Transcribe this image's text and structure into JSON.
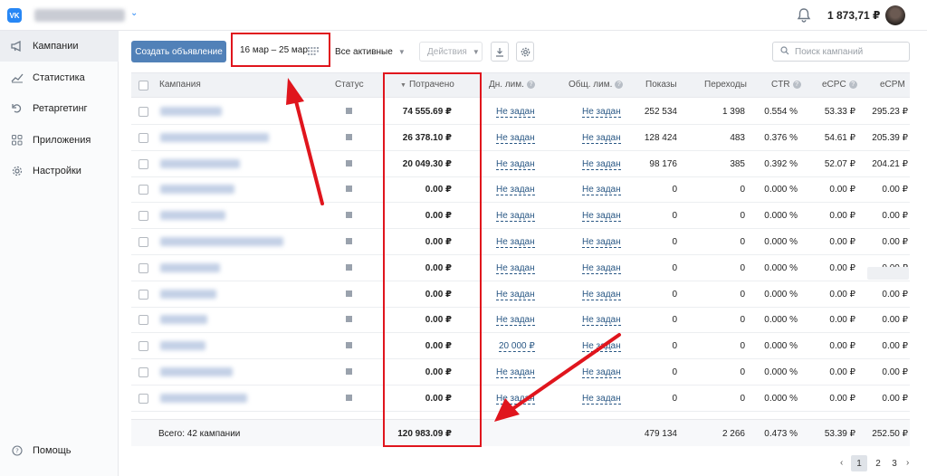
{
  "topbar": {
    "logo_text": "VK",
    "balance": "1 873,71 ₽",
    "icons": {
      "notifications": "bell-icon",
      "account_menu": "chevron-down-icon"
    }
  },
  "sidebar": {
    "items": [
      {
        "label": "Кампании",
        "icon": "megaphone-icon",
        "active": true
      },
      {
        "label": "Статистика",
        "icon": "chart-icon",
        "active": false
      },
      {
        "label": "Ретаргетинг",
        "icon": "retarget-icon",
        "active": false
      },
      {
        "label": "Приложения",
        "icon": "apps-icon",
        "active": false
      },
      {
        "label": "Настройки",
        "icon": "gear-icon",
        "active": false
      }
    ],
    "help_label": "Помощь"
  },
  "toolbar": {
    "create_label": "Создать объявление",
    "date_range": "16 мар – 25 мар",
    "filter_label": "Все активные",
    "actions_label": "Действия",
    "search_placeholder": "Поиск кампаний"
  },
  "table": {
    "headers": {
      "campaign": "Кампания",
      "status": "Статус",
      "spent": "Потрачено",
      "day_limit": "Дн. лим.",
      "total_limit": "Общ. лим.",
      "impressions": "Показы",
      "clicks": "Переходы",
      "ctr": "CTR",
      "ecpc": "eCPC",
      "ecpm": "eCPM"
    },
    "rows": [
      {
        "spent": "74 555.69 ₽",
        "day_limit": "Не задан",
        "total_limit": "Не задан",
        "impressions": "252 534",
        "clicks": "1 398",
        "ctr": "0.554 %",
        "ecpc": "53.33 ₽",
        "ecpm": "295.23 ₽"
      },
      {
        "spent": "26 378.10 ₽",
        "day_limit": "Не задан",
        "total_limit": "Не задан",
        "impressions": "128 424",
        "clicks": "483",
        "ctr": "0.376 %",
        "ecpc": "54.61 ₽",
        "ecpm": "205.39 ₽"
      },
      {
        "spent": "20 049.30 ₽",
        "day_limit": "Не задан",
        "total_limit": "Не задан",
        "impressions": "98 176",
        "clicks": "385",
        "ctr": "0.392 %",
        "ecpc": "52.07 ₽",
        "ecpm": "204.21 ₽"
      },
      {
        "spent": "0.00 ₽",
        "day_limit": "Не задан",
        "total_limit": "Не задан",
        "impressions": "0",
        "clicks": "0",
        "ctr": "0.000 %",
        "ecpc": "0.00 ₽",
        "ecpm": "0.00 ₽"
      },
      {
        "spent": "0.00 ₽",
        "day_limit": "Не задан",
        "total_limit": "Не задан",
        "impressions": "0",
        "clicks": "0",
        "ctr": "0.000 %",
        "ecpc": "0.00 ₽",
        "ecpm": "0.00 ₽"
      },
      {
        "spent": "0.00 ₽",
        "day_limit": "Не задан",
        "total_limit": "Не задан",
        "impressions": "0",
        "clicks": "0",
        "ctr": "0.000 %",
        "ecpc": "0.00 ₽",
        "ecpm": "0.00 ₽"
      },
      {
        "spent": "0.00 ₽",
        "day_limit": "Не задан",
        "total_limit": "Не задан",
        "impressions": "0",
        "clicks": "0",
        "ctr": "0.000 %",
        "ecpc": "0.00 ₽",
        "ecpm": "0.00 ₽"
      },
      {
        "spent": "0.00 ₽",
        "day_limit": "Не задан",
        "total_limit": "Не задан",
        "impressions": "0",
        "clicks": "0",
        "ctr": "0.000 %",
        "ecpc": "0.00 ₽",
        "ecpm": "0.00 ₽"
      },
      {
        "spent": "0.00 ₽",
        "day_limit": "Не задан",
        "total_limit": "Не задан",
        "impressions": "0",
        "clicks": "0",
        "ctr": "0.000 %",
        "ecpc": "0.00 ₽",
        "ecpm": "0.00 ₽"
      },
      {
        "spent": "0.00 ₽",
        "day_limit": "20 000 ₽",
        "total_limit": "Не задан",
        "impressions": "0",
        "clicks": "0",
        "ctr": "0.000 %",
        "ecpc": "0.00 ₽",
        "ecpm": "0.00 ₽"
      },
      {
        "spent": "0.00 ₽",
        "day_limit": "Не задан",
        "total_limit": "Не задан",
        "impressions": "0",
        "clicks": "0",
        "ctr": "0.000 %",
        "ecpc": "0.00 ₽",
        "ecpm": "0.00 ₽"
      },
      {
        "spent": "0.00 ₽",
        "day_limit": "Не задан",
        "total_limit": "Не задан",
        "impressions": "0",
        "clicks": "0",
        "ctr": "0.000 %",
        "ecpc": "0.00 ₽",
        "ecpm": "0.00 ₽"
      }
    ],
    "totals": {
      "label": "Всего: 42 кампании",
      "spent": "120 983.09 ₽",
      "impressions": "479 134",
      "clicks": "2 266",
      "ctr": "0.473 %",
      "ecpc": "53.39 ₽",
      "ecpm": "252.50 ₽"
    }
  },
  "pagination": {
    "pages": [
      "1",
      "2",
      "3"
    ],
    "current": "1",
    "prev": "‹",
    "next": "›"
  },
  "colors": {
    "accent": "#5181b8",
    "link": "#2a5885",
    "highlight": "#e0151d"
  }
}
